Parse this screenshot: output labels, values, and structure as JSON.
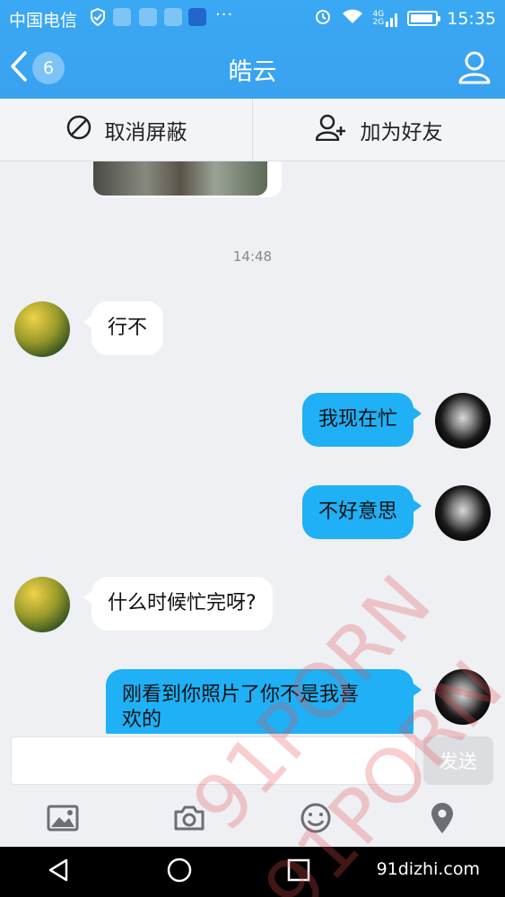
{
  "status": {
    "carrier": "中国电信",
    "time": "15:35",
    "net_top": "4G",
    "net_bottom": "2G"
  },
  "nav": {
    "back_count": "6",
    "title": "皓云"
  },
  "actions": {
    "unblock": "取消屏蔽",
    "add_friend": "加为好友"
  },
  "chat": {
    "timestamp": "14:48",
    "messages": [
      {
        "side": "in",
        "text": "行不"
      },
      {
        "side": "out",
        "text": "我现在忙"
      },
      {
        "side": "out",
        "text": "不好意思"
      },
      {
        "side": "in",
        "text": "什么时候忙完呀?"
      },
      {
        "side": "out",
        "text": "刚看到你照片了你不是我喜\n欢的"
      }
    ]
  },
  "input": {
    "send_label": "发送",
    "placeholder": ""
  },
  "watermark": {
    "text1": "91PORN",
    "text2": "91PORN",
    "site": "91dizhi.com"
  },
  "colors": {
    "header": "#39a2f0",
    "bubble_out": "#1fb0f5",
    "bubble_in": "#ffffff"
  }
}
